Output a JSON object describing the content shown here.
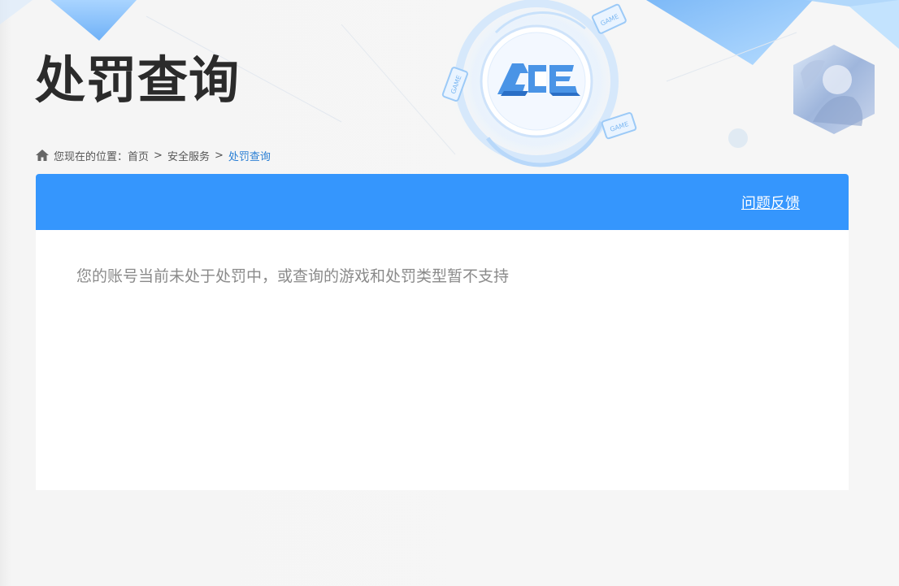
{
  "header": {
    "title": "处罚查询",
    "logo_text": "ACE",
    "badge_text": "GAME"
  },
  "breadcrumb": {
    "prefix": "您现在的位置：",
    "items": [
      "首页",
      "安全服务",
      "处罚查询"
    ],
    "separator": ">"
  },
  "panel": {
    "feedback_label": "问题反馈",
    "message": "您的账号当前未处于处罚中，或查询的游戏和处罚类型暂不支持"
  },
  "colors": {
    "accent": "#3596fd",
    "title": "#2b2b2b",
    "breadcrumb_current": "#2a7fd4",
    "message": "#8a8a8a"
  }
}
